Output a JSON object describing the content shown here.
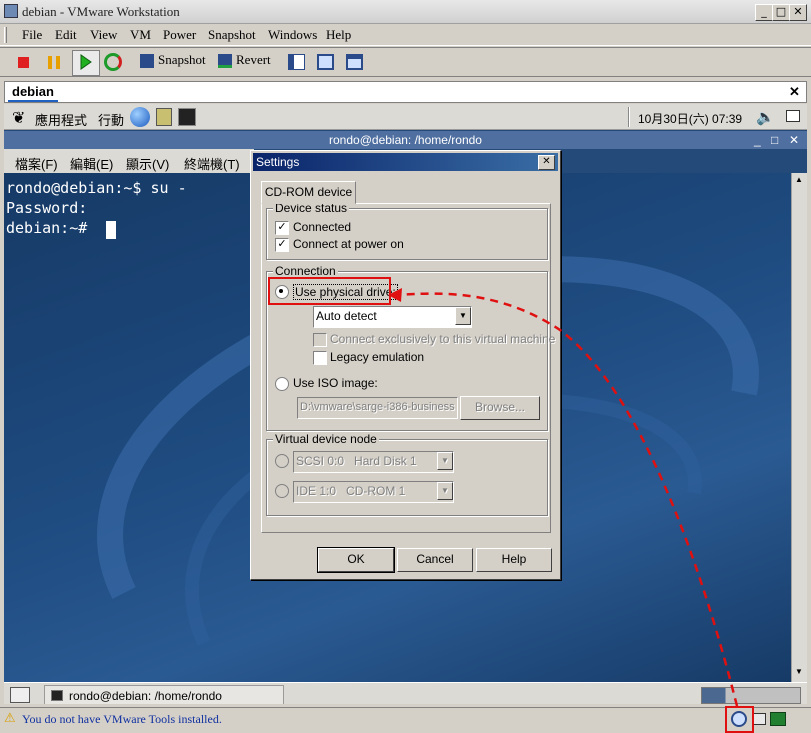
{
  "window": {
    "title": "debian - VMware Workstation"
  },
  "menu": [
    "File",
    "Edit",
    "View",
    "VM",
    "Power",
    "Snapshot",
    "Windows",
    "Help"
  ],
  "toolbar": {
    "snapshot": "Snapshot",
    "revert": "Revert"
  },
  "tab": {
    "label": "debian",
    "close": "✕"
  },
  "gnome_top": {
    "apps": "應用程式",
    "actions": "行動",
    "clock": "10月30日(六) 07:39"
  },
  "terminal": {
    "title": "rondo@debian: /home/rondo",
    "menu": [
      "檔案(F)",
      "編輯(E)",
      "顯示(V)",
      "終端機(T)"
    ],
    "lines": [
      "rondo@debian:~$ su -",
      "Password:",
      "debian:~#"
    ]
  },
  "taskbar": {
    "item": "rondo@debian: /home/rondo"
  },
  "dialog": {
    "title": "Settings",
    "tab": "CD-ROM device",
    "device_status": {
      "legend": "Device status",
      "connected": "Connected",
      "connect_at_power_on": "Connect at power on"
    },
    "connection": {
      "legend": "Connection",
      "use_physical": "Use physical drive:",
      "drive": "Auto detect",
      "exclusive": "Connect exclusively to this virtual machine",
      "legacy": "Legacy emulation",
      "use_iso": "Use ISO image:",
      "iso_path": "D:\\vmware\\sarge-i386-business",
      "browse": "Browse..."
    },
    "node": {
      "legend": "Virtual device node",
      "scsi": "SCSI 0:0   Hard Disk 1",
      "ide": "IDE 1:0   CD-ROM 1"
    },
    "buttons": {
      "ok": "OK",
      "cancel": "Cancel",
      "help": "Help"
    }
  },
  "status": {
    "message": "You do not have VMware Tools installed."
  },
  "colors": {
    "annotation": "#e01010",
    "guest_bg": "#234a78"
  }
}
